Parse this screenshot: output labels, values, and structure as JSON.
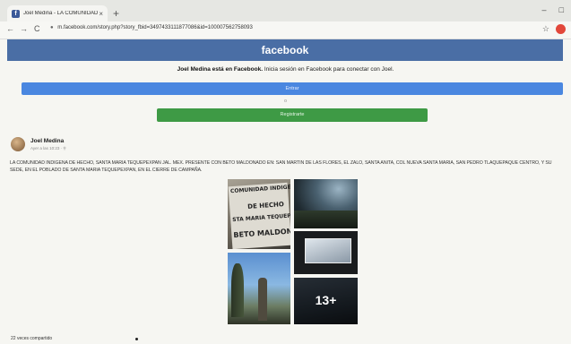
{
  "browser": {
    "tab_title": "Joel Medina - LA COMUNIDAD",
    "tab_close": "×",
    "new_tab": "+",
    "minimize": "–",
    "maximize": "□",
    "nav_back": "←",
    "nav_forward": "→",
    "reload": "C",
    "lock": "🔒",
    "url": "m.facebook.com/story.php?story_fbid=3497433111877086&id=100007562758093",
    "star": "☆"
  },
  "header": {
    "brand": "facebook"
  },
  "login_prompt": {
    "name": "Joel Medina está en Facebook.",
    "text": " Inicia sesión en Facebook para conectar con Joel.",
    "login_button": "Entrar",
    "separator": "o",
    "register_button": "Registrarte"
  },
  "post": {
    "author": "Joel Medina",
    "date": "Ayer a las 10:23 · ⚲",
    "text": "LA COMUNIDAD INDIGENA DE HECHO, SANTA MARIA TEQUEPEXPAN JAL. MEX. PRESENTE CON BETO MALDONADO EN: SAN MARTIN DE LAS FLORES, EL ZALO, SANTA ANITA, COL NUEVA SANTA MARIA, SAN PEDRO TLAQUEPAQUE CENTRO, Y SU SEDE, EN EL POBLADO DE SANTA MARIA TEQUEPEXPAN, EN EL CIERRE DE CAMPAÑA.",
    "sign_lines": [
      "COMUNIDAD INDIGENA",
      "DE HECHO",
      "STA MARIA TEQUEPEX",
      "BETO MALDONADO"
    ],
    "more_photos": "13+",
    "shares": "22 veces compartido"
  }
}
